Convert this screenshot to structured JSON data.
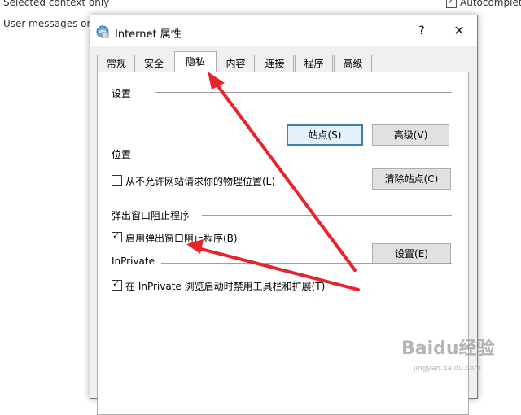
{
  "background": {
    "left_texts": [
      "Selected context only",
      "User messages only"
    ],
    "right_checkbox_label": "Autocomplete"
  },
  "window": {
    "title": "Internet 属性",
    "help_label": "?",
    "close_label": "✕",
    "icon": "internet-options-icon"
  },
  "tabs": [
    "常规",
    "安全",
    "隐私",
    "内容",
    "连接",
    "程序",
    "高级"
  ],
  "active_tab": "隐私",
  "sections": {
    "settings": {
      "title": "设置",
      "sites_button": "站点(S)",
      "advanced_button": "高级(V)"
    },
    "location": {
      "title": "位置",
      "checkbox_label": "从不允许网站请求你的物理位置(L)",
      "checked": false,
      "clear_button": "清除站点(C)"
    },
    "popup": {
      "title": "弹出窗口阻止程序",
      "checkbox_label": "启用弹出窗口阻止程序(B)",
      "checked": true,
      "settings_button": "设置(E)"
    },
    "inprivate": {
      "title": "InPrivate",
      "checkbox_label": "在 InPrivate 浏览启动时禁用工具栏和扩展(T)",
      "checked": true
    }
  },
  "watermark": {
    "main": "Baidu经验",
    "sub": "jingyan.baidu.com"
  },
  "colors": {
    "annotation_arrow": "#e8232b",
    "default_button_border": "#3c7fb1"
  }
}
